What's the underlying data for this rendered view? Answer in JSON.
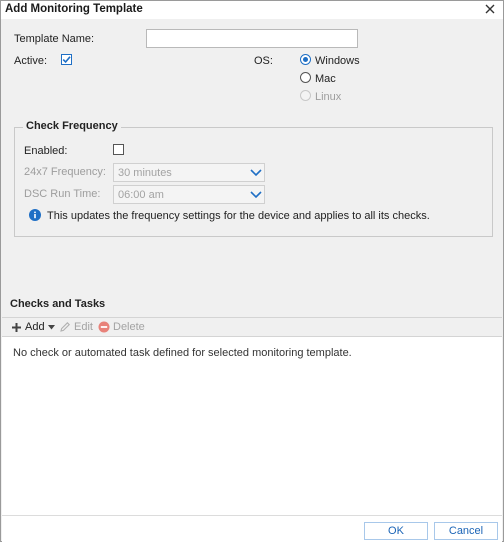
{
  "window": {
    "title": "Add Monitoring Template"
  },
  "form": {
    "template_name_label": "Template Name:",
    "template_name_value": "",
    "active_label": "Active:",
    "active_checked": true,
    "os_label": "OS:",
    "os_options": [
      {
        "label": "Windows",
        "selected": true,
        "enabled": true
      },
      {
        "label": "Mac",
        "selected": false,
        "enabled": true
      },
      {
        "label": "Linux",
        "selected": false,
        "enabled": false
      }
    ]
  },
  "check_frequency": {
    "title": "Check Frequency",
    "enabled_label": "Enabled:",
    "enabled_checked": false,
    "frequency_label": "24x7 Frequency:",
    "frequency_value": "30 minutes",
    "dsc_label": "DSC Run Time:",
    "dsc_value": "06:00 am",
    "info_text": "This updates the frequency settings for the device and applies to all its checks."
  },
  "checks_and_tasks": {
    "title": "Checks and Tasks",
    "toolbar": {
      "add": "Add",
      "edit": "Edit",
      "delete": "Delete"
    },
    "empty_message": "No check or automated task defined for selected monitoring template."
  },
  "footer": {
    "ok": "OK",
    "cancel": "Cancel"
  },
  "colors": {
    "accent": "#1f6fc5",
    "delete_icon": "#e8827a",
    "background": "#f0f0f0"
  }
}
